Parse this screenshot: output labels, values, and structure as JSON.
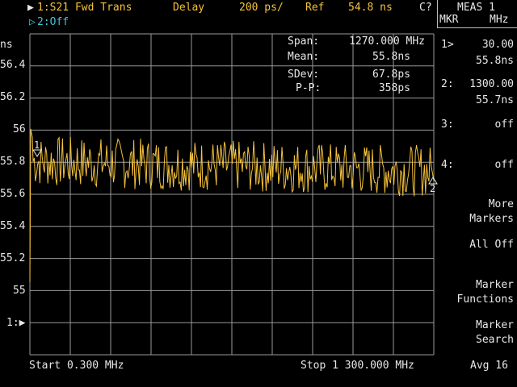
{
  "header": {
    "trace1_marker": "▶",
    "trace1_label": "1:S21 Fwd Trans",
    "format": "Delay",
    "scale": "200 ps/",
    "ref_label": "Ref",
    "ref_value": "54.8 ns",
    "cal_status": "C?",
    "trace2_marker": "▷",
    "trace2_label": "2:Off",
    "units": "ns"
  },
  "stats": {
    "span_label": "Span:",
    "span_value": "1270.000 MHz",
    "mean_label": "Mean:",
    "mean_value": "55.8ns",
    "sdev_label": "SDev:",
    "sdev_value": "67.8ps",
    "pp_label": "P-P:",
    "pp_value": "358ps"
  },
  "y_ticks": [
    "56.4",
    "56.2",
    "56",
    "55.8",
    "55.6",
    "55.4",
    "55.2",
    "55"
  ],
  "ref_marker_label": "1:▶",
  "footer": {
    "start": "Start 0.300 MHz",
    "stop": "Stop 1 300.000 MHz",
    "avg": "Avg 16"
  },
  "menu": {
    "title": "MEAS 1",
    "sub_left": "MKR",
    "sub_right": "MHz",
    "markers": [
      {
        "num": "1>",
        "freq": "30.00",
        "value": "55.8ns"
      },
      {
        "num": "2:",
        "freq": "1300.00",
        "value": "55.7ns"
      },
      {
        "num": "3:",
        "freq": "off",
        "value": ""
      },
      {
        "num": "4:",
        "freq": "off",
        "value": ""
      }
    ],
    "more_markers_1": "More",
    "more_markers_2": "Markers",
    "all_off": "All Off",
    "marker_functions_1": "Marker",
    "marker_functions_2": "Functions",
    "marker_search_1": "Marker",
    "marker_search_2": "Search"
  },
  "trace_markers": {
    "m1": "1",
    "m2": "2"
  },
  "colors": {
    "trace": "#f5c23a",
    "grid": "#9a9a9a",
    "text": "#e8e8e8",
    "cyan": "#3fc7d6"
  },
  "chart_data": {
    "type": "line",
    "x_start_mhz": 0.3,
    "x_stop_mhz": 1300.0,
    "ylim": [
      54.8,
      56.6
    ],
    "y_ticks": [
      55.0,
      55.2,
      55.4,
      55.6,
      55.8,
      56.0,
      56.2,
      56.4
    ],
    "grid": true,
    "series": [
      {
        "name": "S21 Fwd Trans",
        "mean": 55.8,
        "sdev_ps": 67.8,
        "pp_ps": 358
      }
    ],
    "markers": [
      {
        "label": "1",
        "x_mhz": 30.0,
        "y": 55.8
      },
      {
        "label": "2",
        "x_mhz": 1300.0,
        "y": 55.7
      }
    ]
  }
}
